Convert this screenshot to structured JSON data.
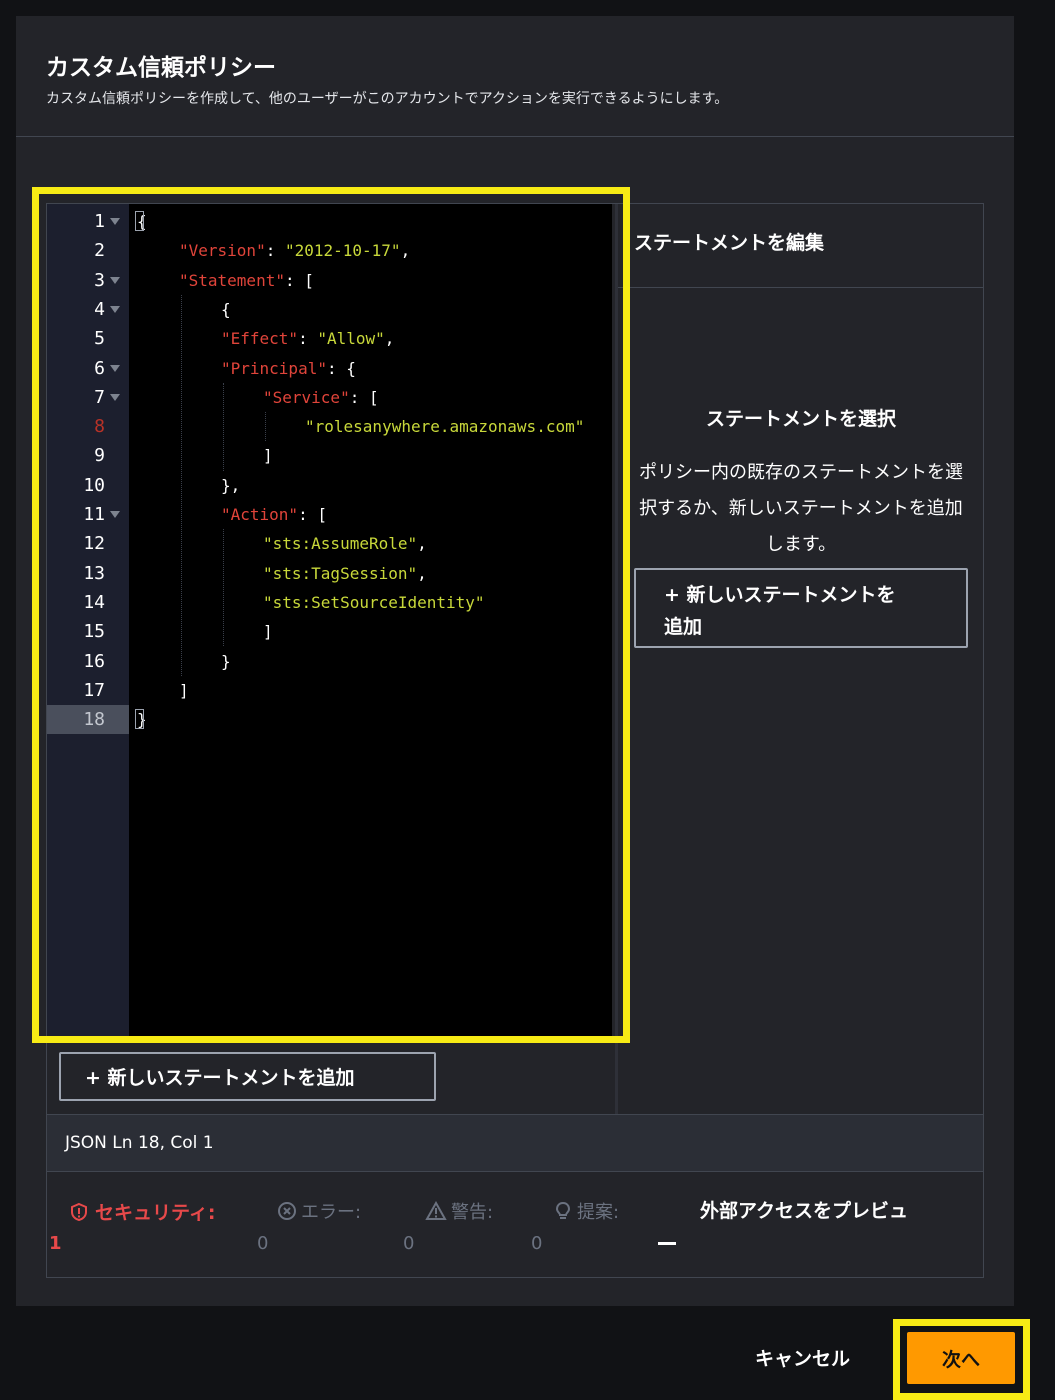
{
  "header": {
    "title": "カスタム信頼ポリシー",
    "subtitle": "カスタム信頼ポリシーを作成して、他のユーザーがこのアカウントでアクションを実行できるようにします。"
  },
  "editor": {
    "line_numbers": [
      "1",
      "2",
      "3",
      "4",
      "5",
      "6",
      "7",
      "8",
      "9",
      "10",
      "11",
      "12",
      "13",
      "14",
      "15",
      "16",
      "17",
      "18"
    ],
    "lines": [
      {
        "plain": "{"
      },
      {
        "key": "\"Version\"",
        "sep": ": ",
        "str": "\"2012-10-17\"",
        "tail": ","
      },
      {
        "key": "\"Statement\"",
        "sep": ": ["
      },
      {
        "plain": "{"
      },
      {
        "key": "\"Effect\"",
        "sep": ": ",
        "str": "\"Allow\"",
        "tail": ","
      },
      {
        "key": "\"Principal\"",
        "sep": ": {"
      },
      {
        "key": "\"Service\"",
        "sep": ": ["
      },
      {
        "str": "\"rolesanywhere.amazonaws.com\""
      },
      {
        "plain": "]"
      },
      {
        "plain": "},"
      },
      {
        "key": "\"Action\"",
        "sep": ": ["
      },
      {
        "str": "\"sts:AssumeRole\"",
        "tail": ","
      },
      {
        "str": "\"sts:TagSession\"",
        "tail": ","
      },
      {
        "str": "\"sts:SetSourceIdentity\""
      },
      {
        "plain": "]"
      },
      {
        "plain": "}"
      },
      {
        "plain": "]"
      },
      {
        "plain": "}"
      }
    ],
    "add_statement_label": "+ 新しいステートメントを追加"
  },
  "right_panel": {
    "title": "ステートメントを編集",
    "select_title": "ステートメントを選択",
    "select_desc": "ポリシー内の既存のステートメントを選択するか、新しいステートメントを追加します。",
    "add_button_line1": "+ 新しいステートメントを",
    "add_button_line2": "追加"
  },
  "status_bar": {
    "text": "JSON   Ln 18, Col 1"
  },
  "summary": {
    "security_label": "セキュリティ:",
    "security_count": "1",
    "errors_label": "エラー:",
    "errors_count": "0",
    "warnings_label": "警告:",
    "warnings_count": "0",
    "suggestions_label": "提案:",
    "suggestions_count": "0",
    "preview_label": "外部アクセスをプレビュ"
  },
  "footer": {
    "cancel_label": "キャンセル",
    "next_label": "次へ"
  },
  "colors": {
    "accent": "#ff9900",
    "highlight": "#f7eb15",
    "json_key": "#e0443a",
    "json_string": "#c8d83a",
    "security": "#e7494a"
  }
}
